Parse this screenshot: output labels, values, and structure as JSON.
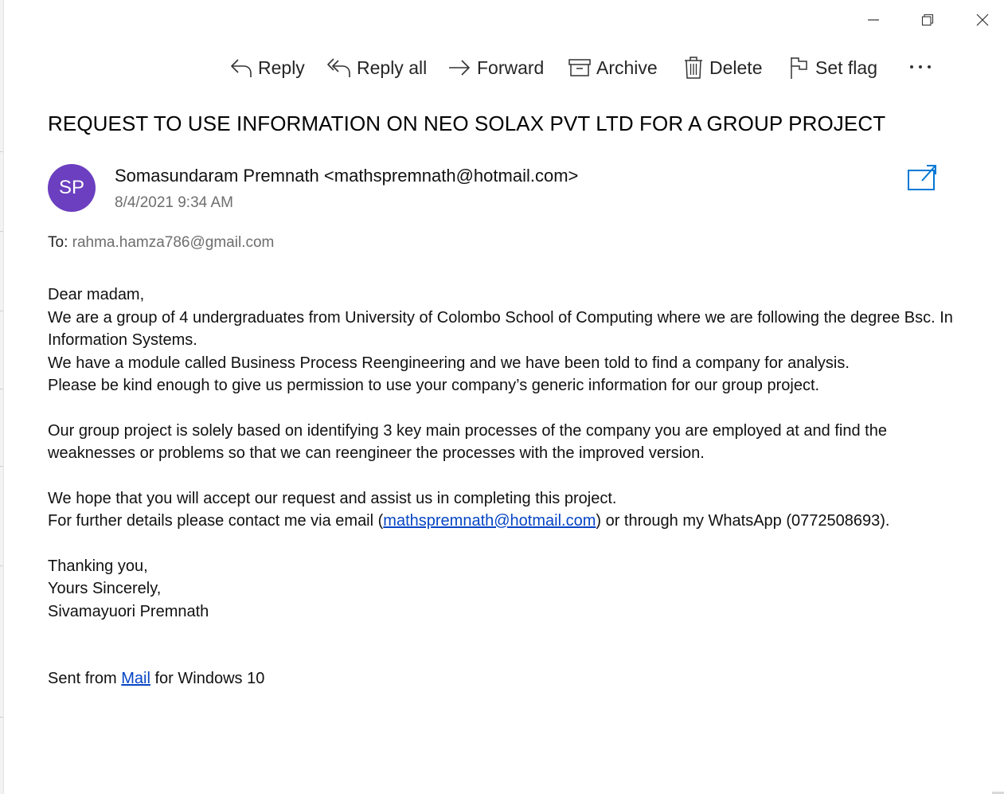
{
  "window": {
    "minimize_icon": "minimize-icon",
    "restore_icon": "restore-icon",
    "close_icon": "close-icon"
  },
  "toolbar": {
    "reply": "Reply",
    "reply_all": "Reply all",
    "forward": "Forward",
    "archive": "Archive",
    "delete": "Delete",
    "set_flag": "Set flag",
    "more": "···"
  },
  "email": {
    "subject": "REQUEST TO USE INFORMATION ON NEO SOLAX PVT LTD FOR A GROUP PROJECT",
    "avatar_initials": "SP",
    "avatar_color": "#6b3fbf",
    "sender": "Somasundaram Premnath <mathspremnath@hotmail.com>",
    "date": "8/4/2021 9:34 AM",
    "to_label": "To:",
    "to_address": "rahma.hamza786@gmail.com",
    "body": {
      "greeting": "Dear madam,",
      "p1_line1": "We are a group of 4 undergraduates from University of Colombo School of Computing where we are following the degree Bsc. In Information Systems.",
      "p1_line2": "We have a module called Business Process Reengineering and we have been told to find a company for analysis.",
      "p1_line3": "Please be kind enough to give us permission to use your company’s generic information for our group project.",
      "p2": "Our group project is solely based on identifying 3 key main processes of the company you are employed at and find the weaknesses or problems so that we can reengineer the processes with the improved version.",
      "p3_line1": "We hope that you will accept our request and assist us in completing this project.",
      "p3_line2_prefix": "For further details please contact me via email (",
      "p3_line2_link": "mathspremnath@hotmail.com",
      "p3_line2_suffix": ") or through my WhatsApp (0772508693).",
      "closing1": "Thanking you,",
      "closing2": "Yours Sincerely,",
      "signature": "Sivamayuori Premnath",
      "sent_prefix": "Sent from ",
      "sent_link": "Mail",
      "sent_suffix": " for Windows 10"
    }
  },
  "colors": {
    "accent": "#0078d4",
    "link": "#0645c5"
  }
}
